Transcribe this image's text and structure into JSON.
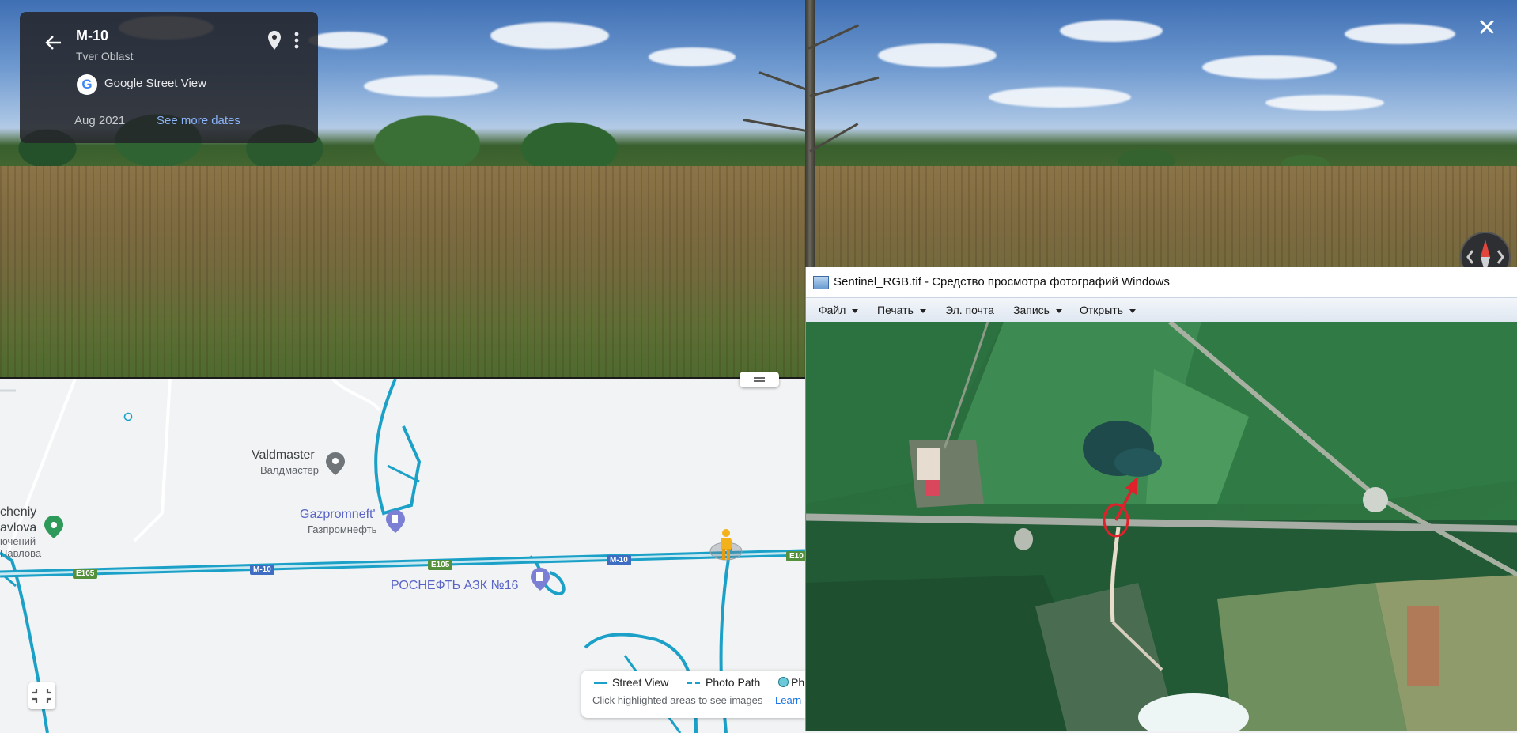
{
  "street_view": {
    "card": {
      "title": "M-10",
      "region": "Tver Oblast",
      "source": "Google Street View",
      "google_logo_letter": "G",
      "date": "Aug 2021",
      "more_dates_link": "See more dates"
    },
    "close_symbol": "✕"
  },
  "map": {
    "pois": [
      {
        "name": "Valdmaster",
        "subname": "Валдмастер"
      },
      {
        "name": "Gazpromneft'",
        "subname": "Газпромнефть"
      },
      {
        "name": "РОСНЕФТЬ АЗК №16"
      },
      {
        "name_partial_1": "cheniy",
        "name_partial_2": "avlova",
        "sub_partial_1": "ючений",
        "sub_partial_2": "Павлова"
      }
    ],
    "road_shields": [
      "E105",
      "M-10",
      "E105",
      "M-10",
      "E10"
    ],
    "legend": {
      "street_view": "Street View",
      "photo_path": "Photo Path",
      "photosphere_partial": "Ph",
      "hint": "Click highlighted areas to see images",
      "learn_partial": "Learn"
    }
  },
  "photo_viewer": {
    "title": "Sentinel_RGB.tif - Средство просмотра фотографий Windows",
    "menu": [
      {
        "label": "Файл",
        "dropdown": true
      },
      {
        "label": "Печать",
        "dropdown": true
      },
      {
        "label": "Эл. почта",
        "dropdown": false
      },
      {
        "label": "Запись",
        "dropdown": true
      },
      {
        "label": "Открыть",
        "dropdown": true
      }
    ]
  },
  "colors": {
    "road_highlight": "#1ba0c8",
    "shield_green": "#55913c",
    "shield_blue": "#3f6dc2",
    "annotation_red": "#e0202a",
    "link_blue": "#8ab4f8"
  }
}
